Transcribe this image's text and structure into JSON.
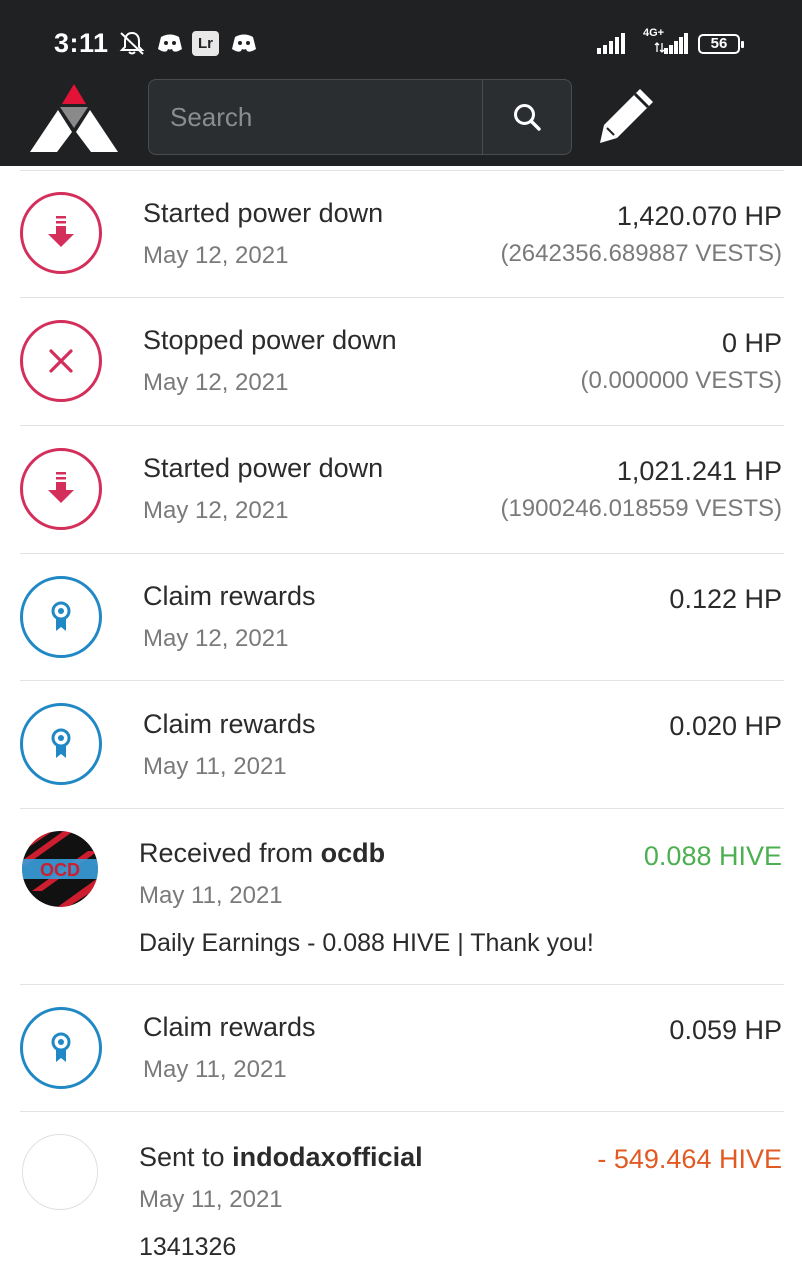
{
  "status_bar": {
    "time": "3:11",
    "app_badge": "Lr",
    "network": "4G+",
    "battery": "56"
  },
  "header": {
    "search": {
      "placeholder": "Search",
      "value": ""
    },
    "icons": [
      "logo",
      "search-icon",
      "pencil-icon"
    ]
  },
  "colors": {
    "header_bg": "#1f2123",
    "power_down_red": "#d42e5b",
    "rewards_blue": "#2188c6",
    "received_green": "#4caf50",
    "sent_orange": "#e25a22"
  },
  "transactions": [
    {
      "icon": "power-down-icon",
      "title": "Started power down",
      "date": "May 12, 2021",
      "amount": "1,420.070 HP",
      "sub_amount": "(2642356.689887 VESTS)"
    },
    {
      "icon": "stop-icon",
      "title": "Stopped power down",
      "date": "May 12, 2021",
      "amount": "0 HP",
      "sub_amount": "(0.000000 VESTS)"
    },
    {
      "icon": "power-down-icon",
      "title": "Started power down",
      "date": "May 12, 2021",
      "amount": "1,021.241 HP",
      "sub_amount": "(1900246.018559 VESTS)"
    },
    {
      "icon": "award-icon",
      "title": "Claim rewards",
      "date": "May 12, 2021",
      "amount": "0.122 HP"
    },
    {
      "icon": "award-icon",
      "title": "Claim rewards",
      "date": "May 11, 2021",
      "amount": "0.020 HP"
    },
    {
      "icon": "user-avatar",
      "title_prefix": "Received from ",
      "title_user": "ocdb",
      "date": "May 11, 2021",
      "amount": "0.088 HIVE",
      "memo": "Daily Earnings - 0.088 HIVE | Thank you!"
    },
    {
      "icon": "award-icon",
      "title": "Claim rewards",
      "date": "May 11, 2021",
      "amount": "0.059 HP"
    },
    {
      "icon": "user-avatar",
      "title_prefix": "Sent to ",
      "title_user": "indodaxofficial",
      "date": "May 11, 2021",
      "amount": "- 549.464 HIVE",
      "memo": "1341326"
    }
  ]
}
